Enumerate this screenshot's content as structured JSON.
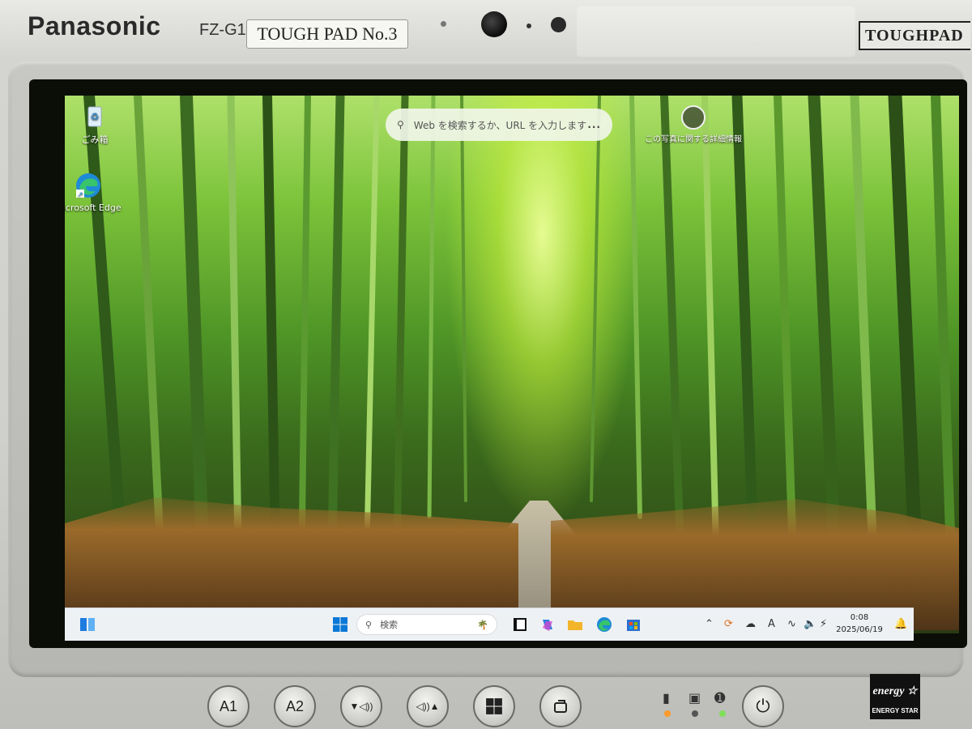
{
  "device": {
    "brand": "Panasonic",
    "model": "FZ-G1",
    "asset_tag": "TOUGH PAD No.3",
    "product_logo": "TOUGHPAD",
    "energy_label": "ENERGY STAR",
    "hardware_buttons": [
      {
        "label": "A1"
      },
      {
        "label": "A2"
      },
      {
        "label": "▼◁))"
      },
      {
        "label": "◁))▲"
      },
      {
        "label": "windows-icon"
      },
      {
        "label": "rotate-icon"
      }
    ],
    "indicators": [
      {
        "icon": "battery-icon",
        "led_color": "#ff9a2a"
      },
      {
        "icon": "storage-icon",
        "led_color": "#555555"
      },
      {
        "icon": "wireless-icon",
        "led_color": "#7ee05a"
      }
    ]
  },
  "desktop": {
    "icons": [
      {
        "label": "ごみ箱",
        "icon": "recycle-bin-icon"
      },
      {
        "label": "Microsoft Edge",
        "icon": "edge-icon"
      }
    ],
    "search": {
      "placeholder": "Web を検索するか、URL を入力します",
      "more": "..."
    },
    "photo_info": {
      "label": "この写真に関する詳細情報"
    }
  },
  "taskbar": {
    "search_label": "検索",
    "apps": [
      "file-explorer-icon",
      "copilot-icon",
      "folder-icon",
      "edge-icon",
      "store-icon"
    ],
    "tray": [
      "chevron-up-icon",
      "sync-icon",
      "onedrive-icon",
      "A",
      "wifi-icon",
      "volume-icon",
      "power-plug-icon"
    ],
    "clock": {
      "time": "0:08",
      "date": "2025/06/19"
    }
  }
}
